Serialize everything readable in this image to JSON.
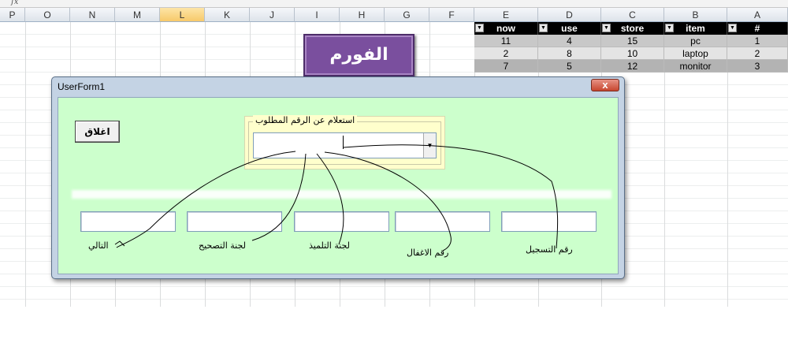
{
  "formula_bar": {
    "fx_icon": "fx"
  },
  "columns": [
    "P",
    "O",
    "N",
    "M",
    "L",
    "K",
    "J",
    "I",
    "H",
    "G",
    "F",
    "E",
    "D",
    "C",
    "B",
    "A"
  ],
  "table": {
    "headers": [
      "now",
      "use",
      "store",
      "item",
      "#"
    ],
    "rows": [
      [
        "11",
        "4",
        "15",
        "pc",
        "1"
      ],
      [
        "2",
        "8",
        "10",
        "laptop",
        "2"
      ],
      [
        "7",
        "5",
        "12",
        "monitor",
        "3"
      ]
    ]
  },
  "sheet_button": {
    "label": "الفورم"
  },
  "userform": {
    "title": "UserForm1",
    "close_glyph": "x",
    "close_button": "اغلاق",
    "frame_caption": "استعلام عن الرقم المطلوب",
    "combo_arrow": "▼",
    "labels": [
      "التالي",
      "لجنة التصحيح",
      "لجنة التلميذ",
      "رقم الاغفال",
      "رقم التسجيل"
    ]
  },
  "colors": {
    "form_background": "#ccffcc",
    "frame_background": "#ffffcc",
    "sheet_button": "#7a4f9e",
    "table_header": "#000000"
  }
}
